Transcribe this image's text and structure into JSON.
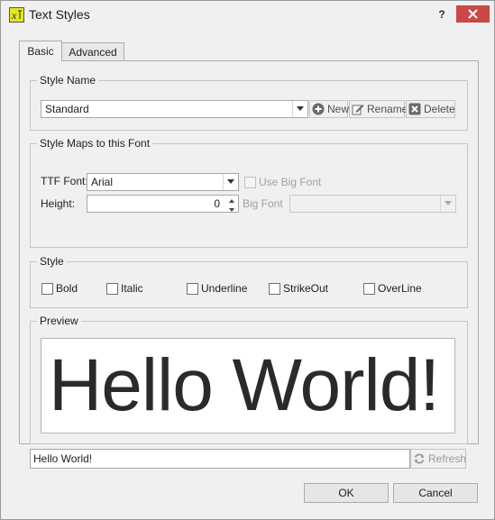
{
  "window": {
    "title": "Text Styles",
    "help_label": "?"
  },
  "tabs": [
    {
      "label": "Basic"
    },
    {
      "label": "Advanced"
    }
  ],
  "style_name": {
    "group_title": "Style Name",
    "selected": "Standard",
    "new_label": "New",
    "rename_label": "Rename",
    "delete_label": "Delete"
  },
  "font_map": {
    "group_title": "Style Maps to this Font",
    "ttf_label": "TTF Font:",
    "ttf_value": "Arial",
    "use_big_font_label": "Use Big Font",
    "height_label": "Height:",
    "height_value": "0",
    "big_font_label": "Big Font",
    "big_font_value": ""
  },
  "style": {
    "group_title": "Style",
    "options": [
      {
        "label": "Bold",
        "checked": false
      },
      {
        "label": "Italic",
        "checked": false
      },
      {
        "label": "Underline",
        "checked": false
      },
      {
        "label": "StrikeOut",
        "checked": false
      },
      {
        "label": "OverLine",
        "checked": false
      }
    ]
  },
  "preview": {
    "group_title": "Preview",
    "display_text": "Hello World!",
    "input_value": "Hello World!",
    "refresh_label": "Refresh"
  },
  "buttons": {
    "ok_label": "OK",
    "cancel_label": "Cancel"
  },
  "colors": {
    "close_button": "#c94848",
    "app_icon": "#e6e61e"
  },
  "icons": {
    "app": "text-style-icon",
    "new": "plus-circle-icon",
    "rename": "rename-icon",
    "delete": "delete-x-icon",
    "refresh": "refresh-icon",
    "close": "close-icon"
  }
}
